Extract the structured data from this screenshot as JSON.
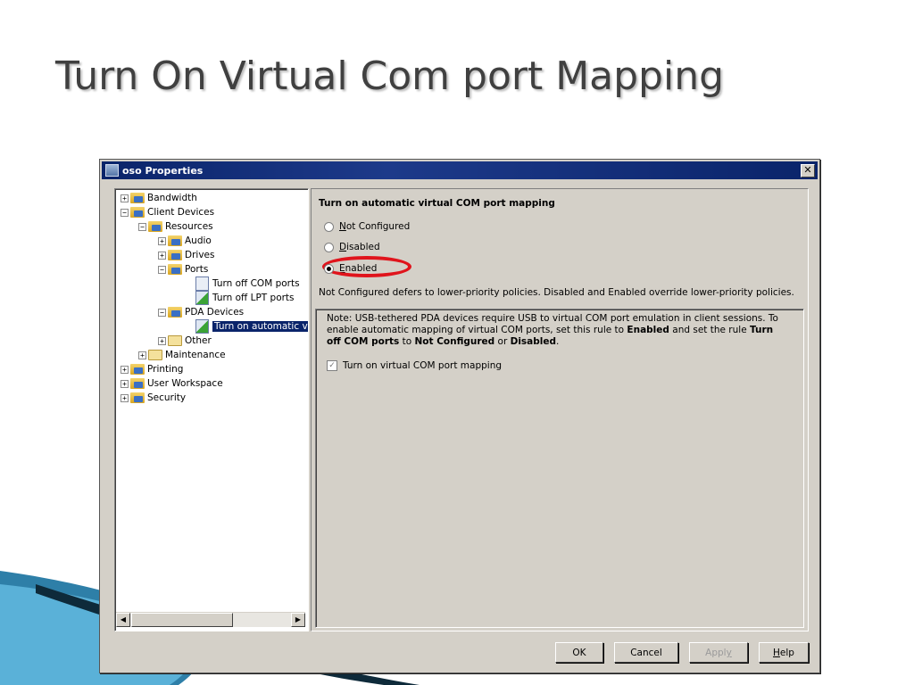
{
  "slide": {
    "title": "Turn On Virtual Com port Mapping"
  },
  "window": {
    "title": "oso Properties",
    "close_label": "✕"
  },
  "tree": {
    "items": [
      {
        "label": "Bandwidth",
        "expander": "+"
      },
      {
        "label": "Client Devices",
        "expander": "−"
      },
      {
        "label": "Resources",
        "expander": "−"
      },
      {
        "label": "Audio",
        "expander": "+"
      },
      {
        "label": "Drives",
        "expander": "+"
      },
      {
        "label": "Ports",
        "expander": "−"
      },
      {
        "label": "Turn off COM ports"
      },
      {
        "label": "Turn off LPT ports"
      },
      {
        "label": "PDA Devices",
        "expander": "−"
      },
      {
        "label": "Turn on automatic v"
      },
      {
        "label": "Other",
        "expander": "+"
      },
      {
        "label": "Maintenance",
        "expander": "+"
      },
      {
        "label": "Printing",
        "expander": "+"
      },
      {
        "label": "User Workspace",
        "expander": "+"
      },
      {
        "label": "Security",
        "expander": "+"
      }
    ],
    "scroll_left": "◀",
    "scroll_right": "▶"
  },
  "policy": {
    "heading": "Turn on automatic virtual COM port mapping",
    "options": [
      {
        "key": "N",
        "rest": "ot Configured",
        "checked": false
      },
      {
        "key": "D",
        "rest": "isabled",
        "checked": false
      },
      {
        "key": "E",
        "rest": "nabled",
        "checked": true
      }
    ],
    "description": "Not Configured defers to lower-priority policies. Disabled and Enabled override lower-priority policies.",
    "note": {
      "p1": "Note: USB-tethered PDA devices require USB to virtual COM port emulation in client sessions. To enable automatic mapping of virtual COM ports, set this rule to ",
      "b1": "Enabled",
      "p2": " and set the rule ",
      "b2": "Turn off COM ports",
      "p3": " to ",
      "b3": "Not Configured",
      "p4": " or ",
      "b4": "Disabled",
      "p5": "."
    },
    "checkbox": {
      "label": "Turn on virtual COM port mapping",
      "checked": true,
      "disabled": true
    }
  },
  "buttons": {
    "ok": "OK",
    "cancel": "Cancel",
    "apply_key": "y",
    "apply_pre": "Appl",
    "help_key": "H",
    "help_rest": "elp"
  },
  "colors": {
    "highlight_ring": "#e0141c",
    "titlebar": "#0a246a",
    "selection": "#0a246a"
  }
}
